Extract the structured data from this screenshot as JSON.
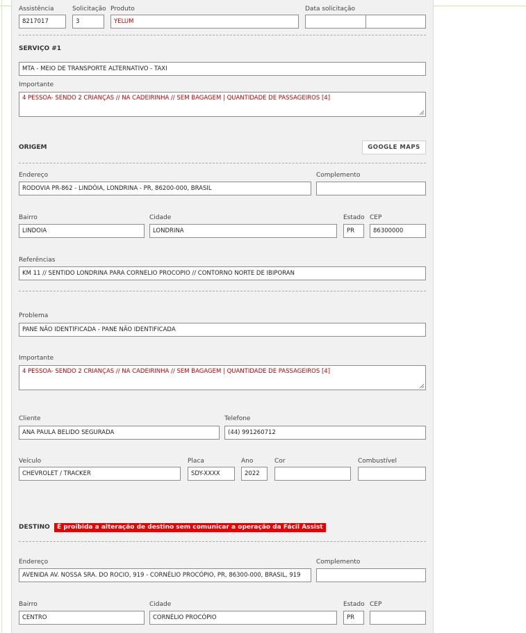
{
  "header_row": {
    "assistencia_label": "Assistência",
    "assistencia_value": "8217017",
    "solicitacao_label": "Solicitação",
    "solicitacao_value": "3",
    "produto_label": "Produto",
    "produto_value": "YELUM",
    "data_label": "Data solicitação",
    "data_value_1": "",
    "data_value_2": ""
  },
  "servico": {
    "title": "SERVIÇO #1",
    "service_value": "MTA - MEIO DE TRANSPORTE ALTERNATIVO - TAXI",
    "importante_label": "Importante",
    "importante_value": "4 PESSOA- SENDO 2 CRIANÇAS // NA CADEIRINHA // SEM BAGAGEM | QUANTIDADE DE PASSAGEIROS [4]"
  },
  "origem": {
    "title": "ORIGEM",
    "maps_button": "GOOGLE MAPS",
    "endereco_label": "Endereço",
    "endereco_value": "RODOVIA PR-862 - LINDÓIA, LONDRINA - PR, 86200-000, BRASIL",
    "complemento_label": "Complemento",
    "complemento_value": "",
    "bairro_label": "Bairro",
    "bairro_value": "LINDOIA",
    "cidade_label": "Cidade",
    "cidade_value": "LONDRINA",
    "estado_label": "Estado",
    "estado_value": "PR",
    "cep_label": "CEP",
    "cep_value": "86300000",
    "referencias_label": "Referências",
    "referencias_value": "KM 11 // SENTIDO LONDRINA PARA CORNELIO PROCOPIO // CONTORNO NORTE DE IBIPORAN"
  },
  "problema": {
    "problema_label": "Problema",
    "problema_value": "PANE NÃO IDENTIFICADA - PANE NÃO IDENTIFICADA",
    "importante_label": "Importante",
    "importante_value": "4 PESSOA- SENDO 2 CRIANÇAS // NA CADEIRINHA // SEM BAGAGEM | QUANTIDADE DE PASSAGEIROS [4]",
    "cliente_label": "Cliente",
    "cliente_value": "ANA PAULA BELIDO SEGURADA",
    "telefone_label": "Telefone",
    "telefone_value": "(44) 991260712",
    "veiculo_label": "Veículo",
    "veiculo_value": "CHEVROLET / TRACKER",
    "placa_label": "Placa",
    "placa_value": "SDY-XXXX",
    "ano_label": "Ano",
    "ano_value": "2022",
    "cor_label": "Cor",
    "cor_value": "",
    "combustivel_label": "Combustível",
    "combustivel_value": ""
  },
  "destino": {
    "title": "DESTINO",
    "warning": "É proibida a alteração de destino sem comunicar a operação da Fácil Assist",
    "endereco_label": "Endereço",
    "endereco_value": "AVENIDA AV. NOSSA SRA. DO ROCIO, 919 - CORNÉLIO PROCÓPIO, PR, 86300-000, BRASIL, 919",
    "complemento_label": "Complemento",
    "complemento_value": "",
    "bairro_label": "Bairro",
    "bairro_value": "CENTRO",
    "cidade_label": "Cidade",
    "cidade_value": "CORNÉLIO PROCÓPIO",
    "estado_label": "Estado",
    "estado_value": "PR",
    "cep_label": "CEP",
    "cep_value": ""
  },
  "colors": {
    "panel": "#f1f1f1",
    "warning_bg": "#e60000",
    "accent_text": "#c00000"
  }
}
